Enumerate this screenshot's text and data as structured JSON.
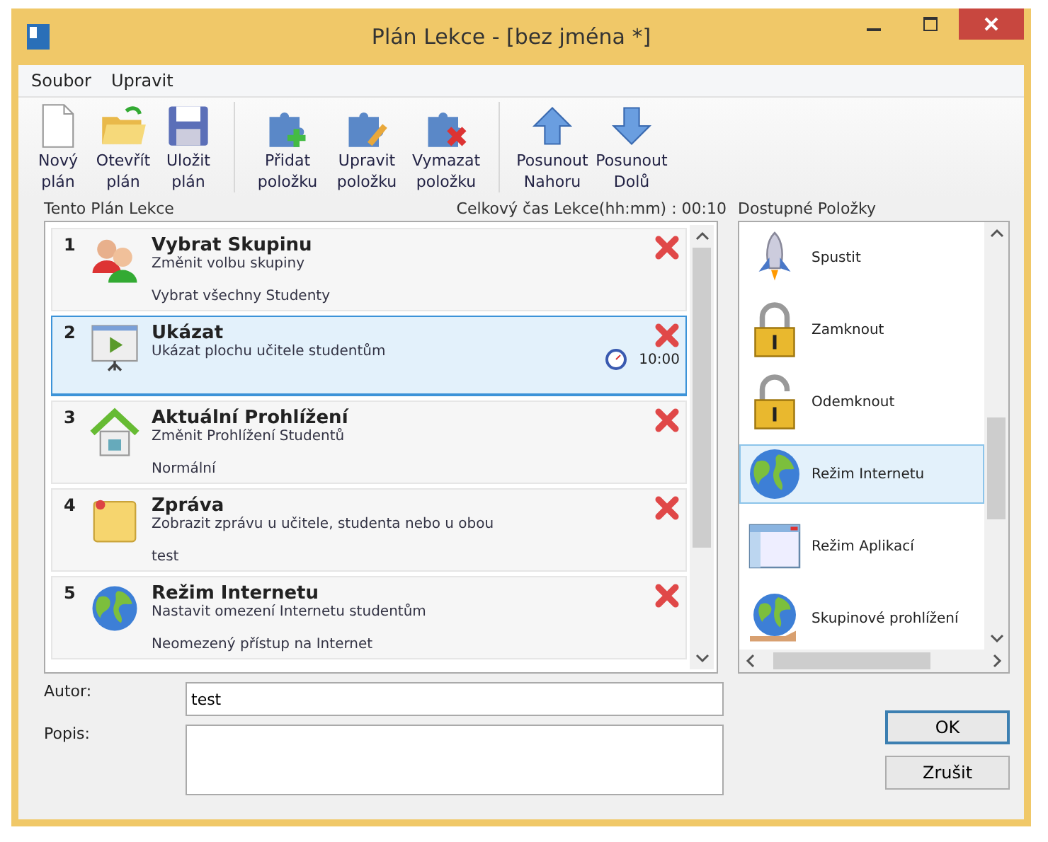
{
  "window": {
    "title": "Plán Lekce - [bez jména *]"
  },
  "menu": [
    "Soubor",
    "Upravit"
  ],
  "toolbar": [
    [
      {
        "kind": "new",
        "label": "Nový plán"
      },
      {
        "kind": "open",
        "label": "Otevřít plán"
      },
      {
        "kind": "save",
        "label": "Uložit plán"
      }
    ],
    [
      {
        "kind": "add",
        "label": "Přidat položku"
      },
      {
        "kind": "edit",
        "label": "Upravit položku"
      },
      {
        "kind": "delete",
        "label": "Vymazat položku"
      }
    ],
    [
      {
        "kind": "up",
        "label": "Posunout Nahoru"
      },
      {
        "kind": "down",
        "label": "Posunout Dolů"
      }
    ]
  ],
  "plan": {
    "heading": "Tento Plán Lekce",
    "total": "Celkový čas Lekce(hh:mm) : 00:10",
    "items": [
      {
        "number": "1",
        "kind": "group",
        "title": "Vybrat Skupinu",
        "description": "Změnit volbu skupiny",
        "detail": "Vybrat všechny Studenty",
        "selected": false
      },
      {
        "number": "2",
        "kind": "show",
        "title": "Ukázat",
        "description": "Ukázat plochu učitele studentům",
        "time": "10:00",
        "selected": true
      },
      {
        "number": "3",
        "kind": "house",
        "title": "Aktuální Prohlížení",
        "description": "Změnit Prohlížení Studentů",
        "detail": "Normální",
        "selected": false
      },
      {
        "number": "4",
        "kind": "note",
        "title": "Zpráva",
        "description": "Zobrazit zprávu u učitele, studenta nebo u obou",
        "detail": "test",
        "selected": false
      },
      {
        "number": "5",
        "kind": "globe",
        "title": "Režim Internetu",
        "description": "Nastavit omezení Internetu studentům",
        "detail": "Neomezený přístup na Internet",
        "selected": false
      }
    ]
  },
  "available": {
    "heading": "Dostupné Položky",
    "items": [
      {
        "kind": "rocket",
        "label": "Spustit",
        "selected": false
      },
      {
        "kind": "lock",
        "label": "Zamknout",
        "selected": false
      },
      {
        "kind": "unlock",
        "label": "Odemknout",
        "selected": false
      },
      {
        "kind": "globe",
        "label": "Režim Internetu",
        "selected": true
      },
      {
        "kind": "window",
        "label": "Režim Aplikací",
        "selected": false
      },
      {
        "kind": "globe-hand",
        "label": "Skupinové prohlížení",
        "selected": false
      }
    ]
  },
  "author": {
    "label": "Autor:",
    "value": "test"
  },
  "description": {
    "label": "Popis:"
  },
  "buttons": [
    {
      "label": "OK",
      "default": true
    },
    {
      "label": "Zrušit",
      "default": false
    }
  ]
}
